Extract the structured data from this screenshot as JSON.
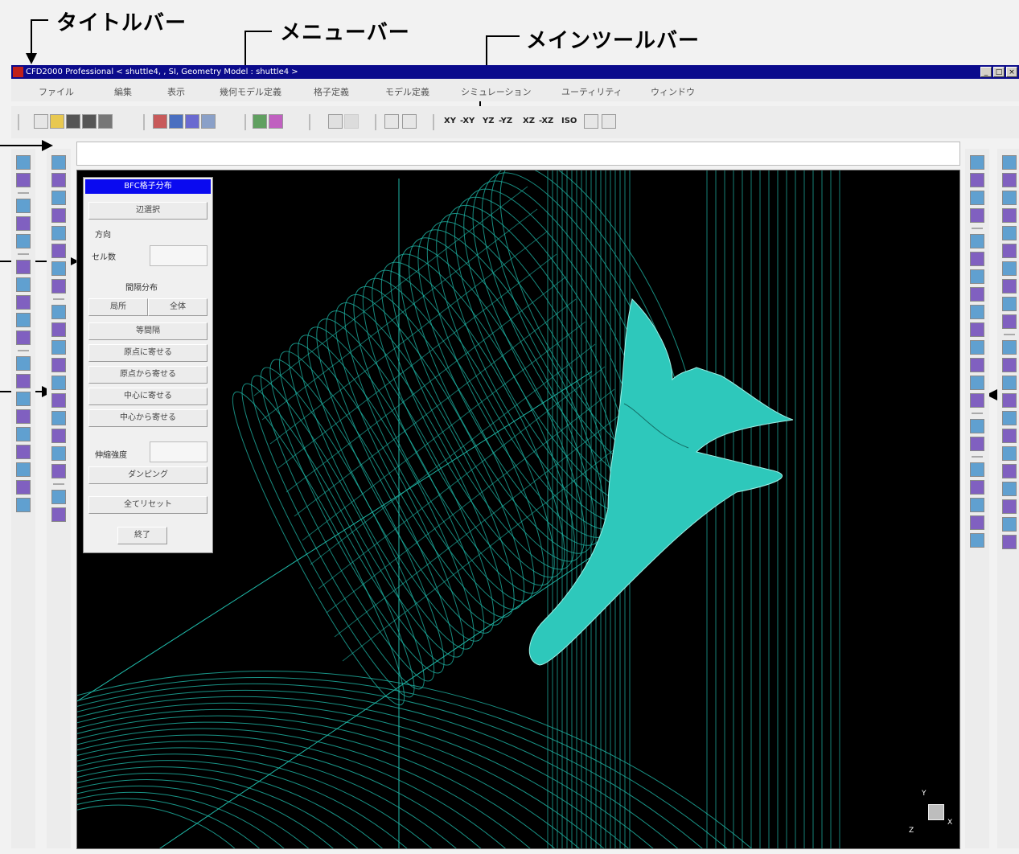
{
  "callouts": {
    "titlebar": "タイトルバー",
    "menubar": "メニューバー",
    "main_toolbar": "メインツールバー"
  },
  "window": {
    "title": "CFD2000 Professional < shuttle4, , SI, Geometry Model : shuttle4 >",
    "minimize": "_",
    "maximize": "□",
    "close": "×"
  },
  "menu": [
    "ファイル",
    "編集",
    "表示",
    "幾何モデル定義",
    "格子定義",
    "モデル定義",
    "シミュレーション",
    "ユーティリティ",
    "ウィンドウ"
  ],
  "toolbar": {
    "view_labels": [
      "XY",
      "-XY",
      "YZ",
      "-YZ",
      "XZ",
      "-XZ",
      "ISO"
    ]
  },
  "dialog": {
    "title": "BFC格子分布",
    "select_button": "辺選択",
    "direction_label": "方向",
    "cell_count_label": "セル数",
    "cell_count_value": "",
    "spacing_heading": "間隔分布",
    "local_button": "局所",
    "global_button": "全体",
    "equal_button": "等間隔",
    "toward_origin_button": "原点に寄せる",
    "from_origin_button": "原点から寄せる",
    "toward_center_button": "中心に寄せる",
    "from_center_button": "中心から寄せる",
    "stretch_label": "伸縮強度",
    "stretch_value": "",
    "damping_button": "ダンピング",
    "reset_all_button": "全てリセット",
    "close_button": "終了"
  },
  "axis_triad": {
    "x": "X",
    "y": "Y",
    "z": "Z"
  },
  "colors": {
    "titlebar": "#0b0b8c",
    "dialog_title": "#0a0af0",
    "mesh": "#1fb8a8",
    "shuttle": "#2ec8bb"
  },
  "icons": {
    "left_strip_1": [
      "cursor-icon",
      "page-icon",
      "mesh-icon",
      "sphere-icon",
      "sphere-icon",
      "green-box-icon",
      "pen-icon",
      "grid-icon",
      "globe-icon",
      "help-icon",
      "delete-icon",
      "delete-icon",
      "list-icon",
      "index-icon",
      "i-index-icon",
      "j-index-icon",
      "k-index-icon",
      "play-icon",
      "rewind-icon"
    ],
    "left_strip_2": [
      "pencil-icon",
      "curve-icon",
      "surface-icon",
      "copy-icon",
      "cube-icon",
      "delete-icon",
      "scale-icon",
      "rotate-icon",
      "line-icon",
      "arc-icon",
      "spline-icon",
      "polyline-icon",
      "box-icon",
      "circle-icon",
      "rectangle-icon",
      "group-icon",
      "block-icon",
      "mesh-edit-icon",
      "transform-icon",
      "target-icon"
    ],
    "right_strip_1": [
      "pan-icon",
      "zoom-in-icon",
      "zoom-box-icon",
      "zoom-out-icon",
      "arrow-left-icon",
      "arrow-right-icon",
      "arrow-up-icon",
      "arrow-down-icon",
      "rotate-x-icon",
      "rotate-y-icon",
      "rotate-z-icon",
      "rotate-z-icon",
      "spin-icon",
      "spin-icon",
      "scatter-icon",
      "fit-icon",
      "xy-view-icon",
      "xz-view-icon",
      "xz-view-icon",
      "front-icon",
      "back-icon"
    ],
    "right_strip_2": [
      "light-icon",
      "shade-icon",
      "blank-icon",
      "rotate-icon",
      "axis-icon",
      "axis-icon",
      "contour-icon",
      "layers-icon",
      "grid-icon",
      "label-icon",
      "push-icon",
      "pull-icon",
      "red-arrow-icon",
      "green-arrow-icon",
      "blue-panel-icon",
      "panel-icon",
      "panel-icon",
      "flow-icon",
      "color-icon",
      "yellow-panel-icon",
      "export-icon",
      "sp-icon"
    ]
  }
}
